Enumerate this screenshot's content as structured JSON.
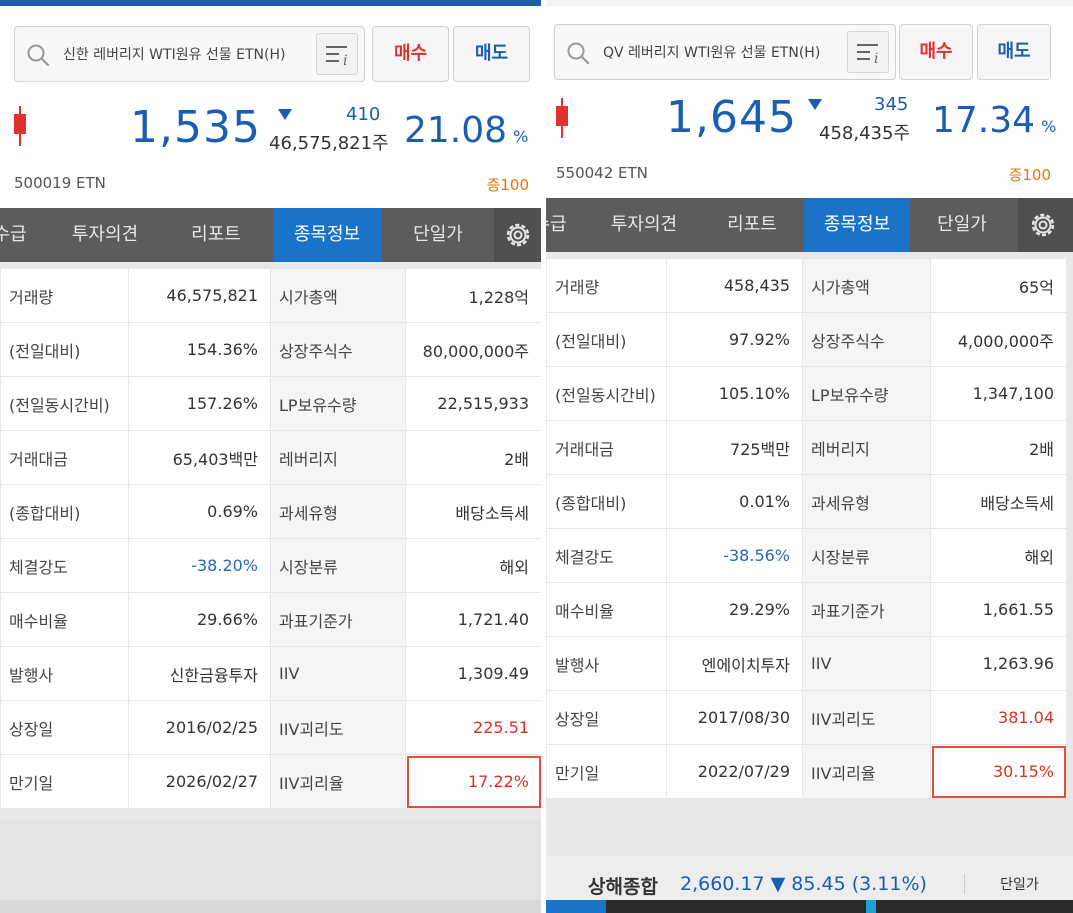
{
  "left": {
    "search": {
      "text": "신한 레버리지 WTI원유 선물 ETN(H)"
    },
    "buy_label": "매수",
    "sell_label": "매도",
    "quote": {
      "price": "1,535",
      "change": "410",
      "volume": "46,575,821주",
      "rate": "21.08",
      "rate_unit": "%",
      "code": "500019  ETN",
      "margin": "증100"
    },
    "tabs": [
      "수급",
      "투자의견",
      "리포트",
      "종목정보",
      "단일가"
    ],
    "rows": [
      {
        "l1": "거래량",
        "v1": "46,575,821",
        "l2": "시가총액",
        "v2": "1,228억"
      },
      {
        "l1": "(전일대비)",
        "v1": "154.36%",
        "l2": "상장주식수",
        "v2": "80,000,000주"
      },
      {
        "l1": "(전일동시간비)",
        "v1": "157.26%",
        "l2": "LP보유수량",
        "v2": "22,515,933"
      },
      {
        "l1": "거래대금",
        "v1": "65,403백만",
        "l2": "레버리지",
        "v2": "2배"
      },
      {
        "l1": "(종합대비)",
        "v1": "0.69%",
        "l2": "과세유형",
        "v2": "배당소득세"
      },
      {
        "l1": "체결강도",
        "v1": "-38.20%",
        "l2": "시장분류",
        "v2": "해외"
      },
      {
        "l1": "매수비율",
        "v1": "29.66%",
        "l2": "과표기준가",
        "v2": "1,721.40"
      },
      {
        "l1": "발행사",
        "v1": "신한금융투자",
        "l2": "IIV",
        "v2": "1,309.49"
      },
      {
        "l1": "상장일",
        "v1": "2016/02/25",
        "l2": "IIV괴리도",
        "v2": "225.51"
      },
      {
        "l1": "만기일",
        "v1": "2026/02/27",
        "l2": "IIV괴리율",
        "v2": "17.22%"
      }
    ]
  },
  "right": {
    "search": {
      "text": "QV 레버리지 WTI원유 선물 ETN(H)"
    },
    "buy_label": "매수",
    "sell_label": "매도",
    "quote": {
      "price": "1,645",
      "change": "345",
      "volume": "458,435주",
      "rate": "17.34",
      "rate_unit": "%",
      "code": "550042  ETN",
      "margin": "증100"
    },
    "tabs": [
      "수급",
      "투자의견",
      "리포트",
      "종목정보",
      "단일가"
    ],
    "rows": [
      {
        "l1": "거래량",
        "v1": "458,435",
        "l2": "시가총액",
        "v2": "65억"
      },
      {
        "l1": "(전일대비)",
        "v1": "97.92%",
        "l2": "상장주식수",
        "v2": "4,000,000주"
      },
      {
        "l1": "(전일동시간비)",
        "v1": "105.10%",
        "l2": "LP보유수량",
        "v2": "1,347,100"
      },
      {
        "l1": "거래대금",
        "v1": "725백만",
        "l2": "레버리지",
        "v2": "2배"
      },
      {
        "l1": "(종합대비)",
        "v1": "0.01%",
        "l2": "과세유형",
        "v2": "배당소득세"
      },
      {
        "l1": "체결강도",
        "v1": "-38.56%",
        "l2": "시장분류",
        "v2": "해외"
      },
      {
        "l1": "매수비율",
        "v1": "29.29%",
        "l2": "과표기준가",
        "v2": "1,661.55"
      },
      {
        "l1": "발행사",
        "v1": "엔에이치투자",
        "l2": "IIV",
        "v2": "1,263.96"
      },
      {
        "l1": "상장일",
        "v1": "2017/08/30",
        "l2": "IIV괴리도",
        "v2": "381.04"
      },
      {
        "l1": "만기일",
        "v1": "2022/07/29",
        "l2": "IIV괴리율",
        "v2": "30.15%"
      }
    ],
    "ticker": {
      "label": "상해종합",
      "value": "2,660.17  ▼ 85.45 (3.11%)",
      "tab": "단일가"
    }
  },
  "colors": {
    "accent": "#1a73c8",
    "up": "#e03131",
    "down": "#1a5db4",
    "margin": "#e8740c"
  }
}
